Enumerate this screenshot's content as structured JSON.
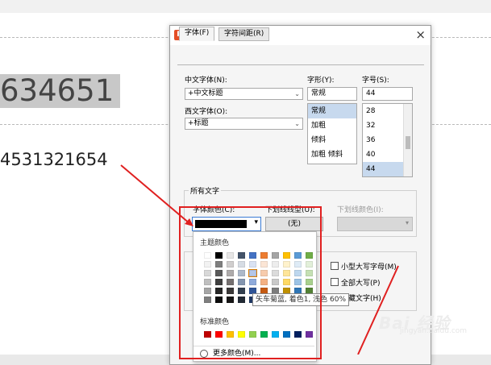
{
  "document": {
    "selected_text": "634651",
    "body_text": "4531321654"
  },
  "dialog": {
    "title": "字体",
    "close_glyph": "×",
    "tabs": [
      "字体(F)",
      "字符间距(R)"
    ],
    "chinese_font": {
      "label": "中文字体(N):",
      "value": "+中文标题"
    },
    "western_font": {
      "label": "西文字体(O):",
      "value": "+标题"
    },
    "style": {
      "label": "字形(Y):",
      "value": "常规",
      "options": [
        "常规",
        "加粗",
        "倾斜",
        "加粗 倾斜"
      ]
    },
    "size": {
      "label": "字号(S):",
      "value": "44",
      "options": [
        "28",
        "32",
        "36",
        "40",
        "44"
      ]
    },
    "all_text_group": "所有文字",
    "font_color_label": "字体颜色(C):",
    "underline_type_label": "下划线线型(U):",
    "underline_type_value": "(无)",
    "underline_color_label": "下划线颜色(I):",
    "checkboxes": [
      "小型大写字母(M)",
      "全部大写(P)",
      "隐藏文字(H)"
    ]
  },
  "color_popup": {
    "theme_label": "主题颜色",
    "standard_label": "标准颜色",
    "more_label": "更多颜色(M)...",
    "tooltip": "矢车菊蓝, 着色1, 浅色 60%",
    "theme_rows": [
      [
        "#ffffff",
        "#000000",
        "#e7e6e6",
        "#44546a",
        "#4472c4",
        "#ed7d31",
        "#a5a5a5",
        "#ffc000",
        "#5b9bd5",
        "#70ad47"
      ],
      [
        "#f2f2f2",
        "#7f7f7f",
        "#d0cece",
        "#d6dce4",
        "#d9e2f3",
        "#fbe5d5",
        "#ededed",
        "#fff2cc",
        "#deebf6",
        "#e2efd9"
      ],
      [
        "#d8d8d8",
        "#595959",
        "#aeabab",
        "#adb9ca",
        "#b4c6e7",
        "#f7cbac",
        "#dbdbdb",
        "#fee599",
        "#bdd7ee",
        "#c5e0b3"
      ],
      [
        "#bfbfbf",
        "#3f3f3f",
        "#757070",
        "#8496b0",
        "#8eaadb",
        "#f4b183",
        "#c9c9c9",
        "#ffd965",
        "#9cc3e5",
        "#a8d08d"
      ],
      [
        "#a5a5a5",
        "#262626",
        "#3a3838",
        "#323f4f",
        "#2f5496",
        "#c55a11",
        "#7b7b7b",
        "#bf9000",
        "#2e75b5",
        "#538135"
      ],
      [
        "#7f7f7f",
        "#0c0c0c",
        "#171616",
        "#222a35",
        "#1f3864",
        "#833c0b",
        "#525252",
        "#7f6000",
        "#1e4e79",
        "#375623"
      ]
    ],
    "standard_colors": [
      "#c00000",
      "#ff0000",
      "#ffc000",
      "#ffff00",
      "#92d050",
      "#00b050",
      "#00b0f0",
      "#0070c0",
      "#002060",
      "#7030a0"
    ],
    "highlighted_cell": "row 2, column 5"
  },
  "annotation": {
    "highlight_color": "#e02020"
  },
  "watermark": {
    "text": "Bai 经验",
    "subtext": "jingyan.baidu.com"
  }
}
